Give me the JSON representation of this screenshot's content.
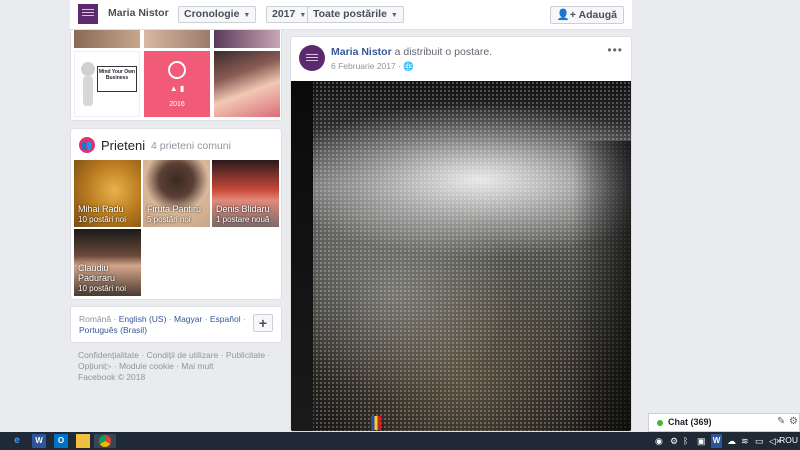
{
  "topbar": {
    "name": "Maria Nistor",
    "tab_timeline": "Cronologie",
    "year": "2017",
    "posts_filter": "Toate postările",
    "add_button": "Adaugă"
  },
  "photos": {
    "sign_text": "Mind Your Own Business",
    "pink_year": "2016"
  },
  "friends": {
    "title": "Prieteni",
    "mutual_count": "4 prieteni comuni",
    "items": [
      {
        "name": "Mihai Radu",
        "sub": "10 postări noi"
      },
      {
        "name": "Firuta Pantiru",
        "sub": "5 postări noi"
      },
      {
        "name": "Denis Blidaru",
        "sub": "1 postare nouă"
      },
      {
        "name": "Claudiu Paduraru",
        "sub": "10 postări noi"
      }
    ]
  },
  "languages": {
    "current": "Română",
    "others": [
      "English (US)",
      "Magyar",
      "Español",
      "Português (Brasil)"
    ]
  },
  "footer": {
    "links": [
      "Confidențialitate",
      "Condiții de utilizare",
      "Publicitate",
      "Opțiuni",
      "Module cookie",
      "Mai mult"
    ],
    "copyright": "Facebook © 2018"
  },
  "post": {
    "author": "Maria Nistor",
    "action": "a distribuit o postare.",
    "date": "6 Februarie 2017",
    "more": "•••"
  },
  "chat": {
    "label": "Chat (369)"
  },
  "taskbar": {
    "lang": "ROU"
  },
  "colors": {
    "link": "#365899",
    "background": "#e9ebee",
    "chat_online": "#42b72a",
    "friends_icon": "#e1306c"
  }
}
